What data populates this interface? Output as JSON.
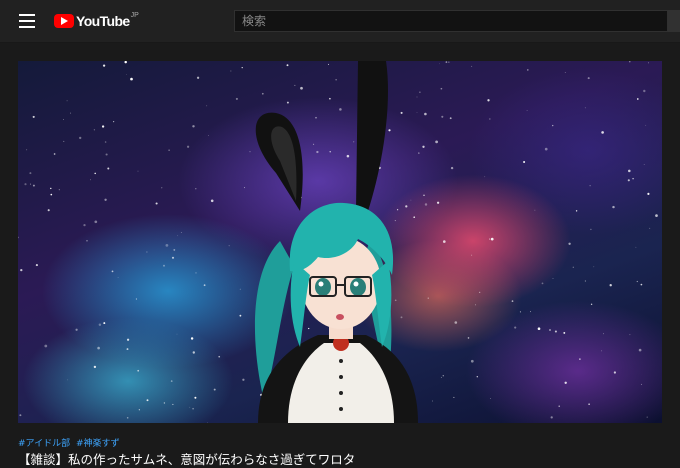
{
  "header": {
    "logo_text": "YouTube",
    "logo_region": "JP",
    "search_placeholder": "検索"
  },
  "video": {
    "hashtags": [
      "#アイドル部",
      "#神楽すず"
    ],
    "title": "【雑談】私の作ったサムネ、意図が伝わらなさ過ぎてワロタ"
  },
  "colors": {
    "background": "#1a1a1a",
    "header": "#212121",
    "brand_red": "#ff0000",
    "hashtag": "#3ea6ff"
  },
  "icons": [
    "menu-icon",
    "youtube-logo-icon"
  ]
}
